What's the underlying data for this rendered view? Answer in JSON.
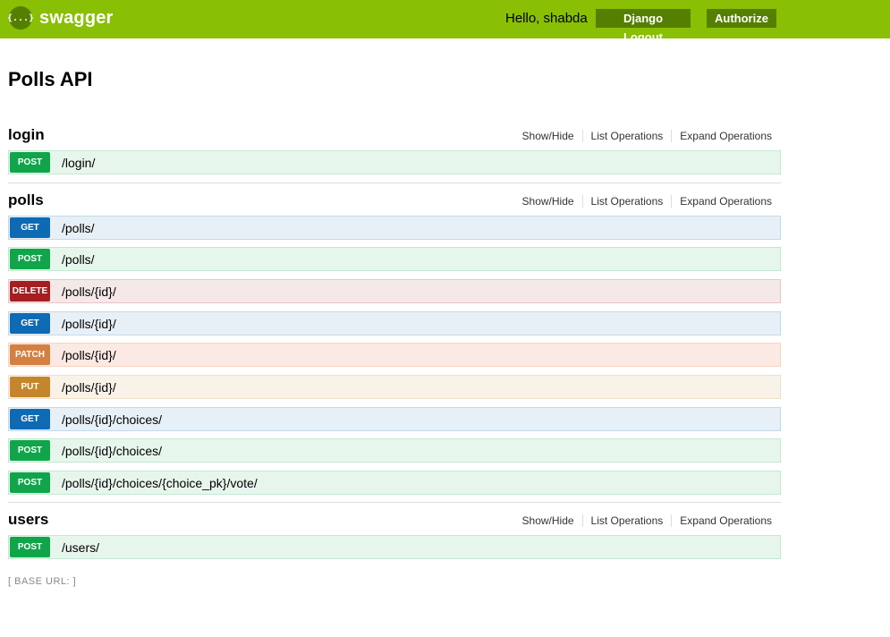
{
  "header": {
    "logo_icon": "{...}",
    "logo_text": "swagger",
    "greeting": "Hello, shabda",
    "logout_label": "Django Logout",
    "authorize_label": "Authorize"
  },
  "page": {
    "title": "Polls API"
  },
  "section_links": {
    "show_hide": "Show/Hide",
    "list_ops": "List Operations",
    "expand_ops": "Expand Operations"
  },
  "sections": [
    {
      "name": "login",
      "ops": [
        {
          "method": "POST",
          "path": "/login/"
        }
      ]
    },
    {
      "name": "polls",
      "ops": [
        {
          "method": "GET",
          "path": "/polls/"
        },
        {
          "method": "POST",
          "path": "/polls/"
        },
        {
          "method": "DELETE",
          "path": "/polls/{id}/"
        },
        {
          "method": "GET",
          "path": "/polls/{id}/"
        },
        {
          "method": "PATCH",
          "path": "/polls/{id}/"
        },
        {
          "method": "PUT",
          "path": "/polls/{id}/"
        },
        {
          "method": "GET",
          "path": "/polls/{id}/choices/"
        },
        {
          "method": "POST",
          "path": "/polls/{id}/choices/"
        },
        {
          "method": "POST",
          "path": "/polls/{id}/choices/{choice_pk}/vote/"
        }
      ]
    },
    {
      "name": "users",
      "ops": [
        {
          "method": "POST",
          "path": "/users/"
        }
      ]
    }
  ],
  "footer": {
    "base_url": "[ BASE URL: ]"
  },
  "colors": {
    "header": "#89bf04",
    "button": "#547f00",
    "post": "#10a54a",
    "get": "#0f6ab4",
    "delete": "#a41e22",
    "patch": "#d38042",
    "put": "#c5862b"
  }
}
